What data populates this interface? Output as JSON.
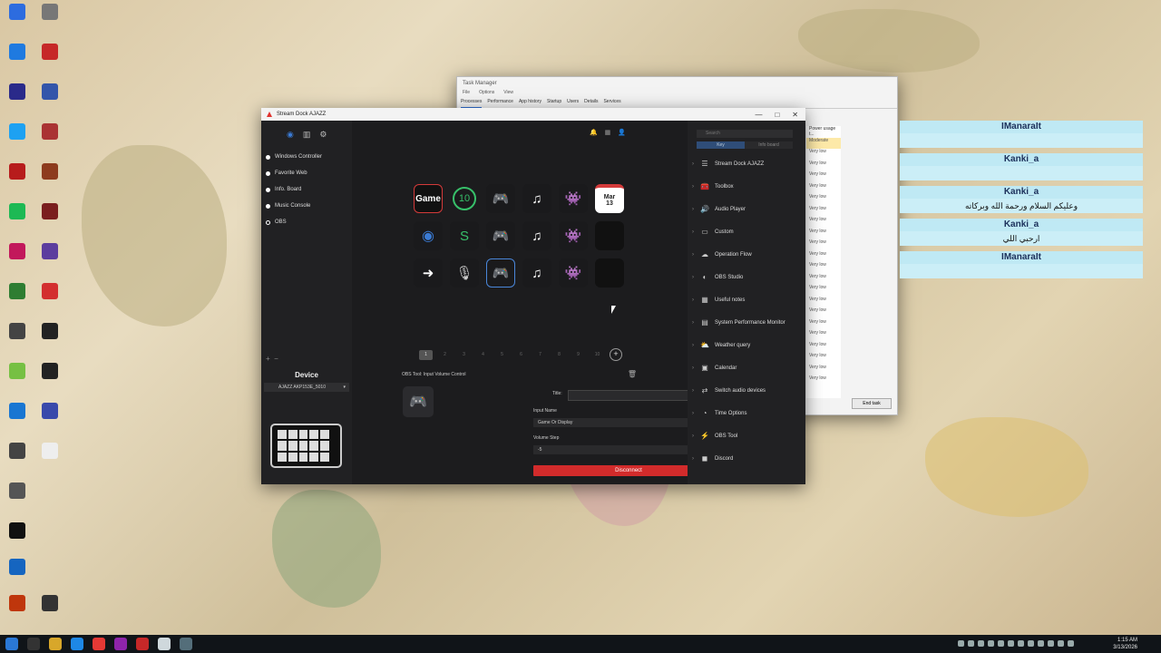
{
  "task_manager": {
    "title": "Task Manager",
    "menu": [
      "File",
      "Options",
      "View"
    ],
    "tabs": [
      "Processes",
      "Performance",
      "App history",
      "Startup",
      "Users",
      "Details",
      "Services"
    ],
    "column_header": "Power usage t...",
    "rows": [
      "Moderate",
      "Very low",
      "Very low",
      "Very low",
      "Very low",
      "Very low",
      "Very low",
      "Very low",
      "Very low",
      "Very low",
      "Very low",
      "Very low",
      "Very low",
      "Very low",
      "Very low",
      "Very low",
      "Very low",
      "Very low",
      "Very low",
      "Very low",
      "Very low",
      "Very low"
    ],
    "end_task": "End task"
  },
  "streamdock": {
    "title": "Stream Dock AJAZZ",
    "window_controls": [
      "—",
      "□",
      "✕"
    ],
    "profiles": [
      {
        "label": "Windows Controller"
      },
      {
        "label": "Favorite Web"
      },
      {
        "label": "Info. Board"
      },
      {
        "label": "Music Console"
      },
      {
        "label": "OBS"
      }
    ],
    "device_label": "Device",
    "device_selected": "AJAZZ AKP153E_5010",
    "keys": [
      {
        "type": "game",
        "label": "Game"
      },
      {
        "type": "ring10",
        "label": "10"
      },
      {
        "type": "gamepad",
        "label": "🎮"
      },
      {
        "type": "music",
        "label": "♫"
      },
      {
        "type": "discord",
        "label": "👾"
      },
      {
        "type": "calendar",
        "month": "Mar",
        "day": "13"
      },
      {
        "type": "eye",
        "label": "◉"
      },
      {
        "type": "spot",
        "label": "S"
      },
      {
        "type": "gamepad",
        "label": "🎮"
      },
      {
        "type": "music",
        "label": "♫"
      },
      {
        "type": "discord",
        "label": "👾"
      },
      {
        "type": "empty",
        "label": ""
      },
      {
        "type": "arrow",
        "label": "➜"
      },
      {
        "type": "mic",
        "label": "🎙"
      },
      {
        "type": "gamepad-selected",
        "label": "🎮"
      },
      {
        "type": "music",
        "label": "♫"
      },
      {
        "type": "discord",
        "label": "👾"
      },
      {
        "type": "empty",
        "label": ""
      }
    ],
    "pages": [
      "1",
      "2",
      "3",
      "4",
      "5",
      "6",
      "7",
      "8",
      "9",
      "10"
    ],
    "current_page": "1",
    "config": {
      "action_title": "OBS Tool: Input Volume Control",
      "title_label": "Title:",
      "input_name_label": "Input Name",
      "input_name_value": "Game Or Display",
      "volume_step_label": "Volume Step",
      "volume_step_value": "-5",
      "disconnect": "Disconnect"
    },
    "search_placeholder": "Search",
    "segment": [
      "Key",
      "Info board"
    ],
    "plugins": [
      {
        "label": "Stream Dock AJAZZ",
        "icon": "☰"
      },
      {
        "label": "Toolbox",
        "icon": "🧰"
      },
      {
        "label": "Audio Player",
        "icon": "🔊"
      },
      {
        "label": "Custom",
        "icon": "▭"
      },
      {
        "label": "Operation Flow",
        "icon": "☁"
      },
      {
        "label": "OBS Studio",
        "icon": "◐"
      },
      {
        "label": "Useful notes",
        "icon": "▦"
      },
      {
        "label": "System Performance Monitor",
        "icon": "▤"
      },
      {
        "label": "Weather query",
        "icon": "⛅"
      },
      {
        "label": "Calendar",
        "icon": "▣"
      },
      {
        "label": "Switch audio devices",
        "icon": "⇄"
      },
      {
        "label": "Time Options",
        "icon": "◔"
      },
      {
        "label": "OBS Tool",
        "icon": "⚡"
      },
      {
        "label": "Discord",
        "icon": "◼"
      }
    ]
  },
  "chat": [
    {
      "user": "IManaraIt",
      "text": ""
    },
    {
      "user": "Kanki_a",
      "text": ""
    },
    {
      "user": "Kanki_a",
      "text": "وعليكم السلام ورحمة الله وبركاته"
    },
    {
      "user": "Kanki_a",
      "text": "ارحبي اللي"
    },
    {
      "user": "IManaraIt",
      "text": ""
    }
  ],
  "clock": {
    "time": "1:15 AM",
    "date": "3/13/2026"
  },
  "colors": {
    "accent": "#3a7bd5",
    "disconnect": "#d22b2b",
    "chat_bg": "#bfe9f4"
  }
}
